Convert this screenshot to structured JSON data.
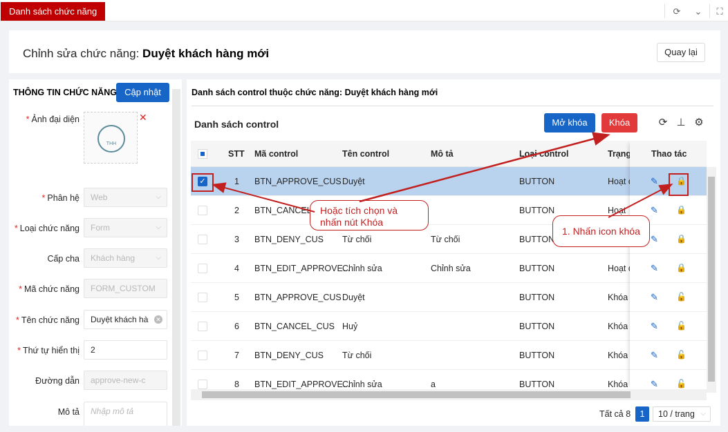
{
  "topbar": {
    "active_tab": "Danh sách chức năng",
    "icons": [
      "refresh-icon",
      "chevron-down-icon",
      "fullscreen-icon"
    ]
  },
  "header": {
    "title_prefix": "Chỉnh sửa chức năng:",
    "title_name": "Duyệt khách hàng mới",
    "back_label": "Quay lại"
  },
  "info": {
    "section_title": "THÔNG TIN CHỨC NĂNG",
    "update_label": "Cập nhật",
    "avatar_label": "Ảnh đại diện",
    "avatar_logo_text": "THH",
    "fields": {
      "system": {
        "label": "Phân hệ",
        "value": "Web"
      },
      "func_type": {
        "label": "Loại chức năng",
        "value": "Form"
      },
      "parent": {
        "label": "Cấp cha",
        "value": "Khách hàng"
      },
      "code": {
        "label": "Mã chức năng",
        "value": "FORM_CUSTOM"
      },
      "name": {
        "label": "Tên chức năng",
        "value": "Duyệt khách hà"
      },
      "order": {
        "label": "Thứ tự hiển thị",
        "value": "2"
      },
      "path": {
        "label": "Đường dẫn",
        "value": "approve-new-c"
      },
      "desc": {
        "label": "Mô tả",
        "placeholder": "Nhập mô tả"
      }
    }
  },
  "controls": {
    "list_title": "Danh sách control thuộc chức năng: Duyệt khách hàng mới",
    "sub_title": "Danh sách control",
    "unlock_label": "Mở khóa",
    "lock_label": "Khóa",
    "columns": {
      "stt": "STT",
      "code": "Mã control",
      "name": "Tên control",
      "desc": "Mô tả",
      "type": "Loại control",
      "status": "Trạng",
      "actions": "Thao tác"
    },
    "rows": [
      {
        "stt": "1",
        "code": "BTN_APPROVE_CUS",
        "name": "Duyệt",
        "desc": "",
        "type": "BUTTON",
        "status": "Hoạt đ",
        "checked": true,
        "locked": false
      },
      {
        "stt": "2",
        "code": "BTN_CANCEL_C",
        "name": "",
        "desc": "",
        "type": "BUTTON",
        "status": "Hoạt",
        "checked": false,
        "locked": false
      },
      {
        "stt": "3",
        "code": "BTN_DENY_CUS",
        "name": "Từ chối",
        "desc": "Từ chối",
        "type": "BUTTON",
        "status": "Hoạt",
        "checked": false,
        "locked": false
      },
      {
        "stt": "4",
        "code": "BTN_EDIT_APPROVE...",
        "name": "Chỉnh sửa",
        "desc": "Chỉnh sửa",
        "type": "BUTTON",
        "status": "Hoạt đ",
        "checked": false,
        "locked": false
      },
      {
        "stt": "5",
        "code": "BTN_APPROVE_CUS",
        "name": "Duyệt",
        "desc": "",
        "type": "BUTTON",
        "status": "Khóa",
        "checked": false,
        "locked": true
      },
      {
        "stt": "6",
        "code": "BTN_CANCEL_CUS",
        "name": "Huỷ",
        "desc": "",
        "type": "BUTTON",
        "status": "Khóa",
        "checked": false,
        "locked": true
      },
      {
        "stt": "7",
        "code": "BTN_DENY_CUS",
        "name": "Từ chối",
        "desc": "",
        "type": "BUTTON",
        "status": "Khóa",
        "checked": false,
        "locked": true
      },
      {
        "stt": "8",
        "code": "BTN_EDIT_APPROVE...",
        "name": "Chỉnh sửa",
        "desc": "a",
        "type": "BUTTON",
        "status": "Khóa",
        "checked": false,
        "locked": true
      }
    ],
    "pager": {
      "total": "Tất cả 8",
      "page": "1",
      "page_size": "10 / trang"
    }
  },
  "annotations": {
    "callout_checkbox": "Hoặc tích chọn và nhấn nút Khóa",
    "callout_icon": "1. Nhấn icon khóa"
  },
  "colors": {
    "primary": "#1765c7",
    "danger": "#e23a3a",
    "tab_red": "#c00000",
    "selected_row": "#b9d2ee"
  }
}
